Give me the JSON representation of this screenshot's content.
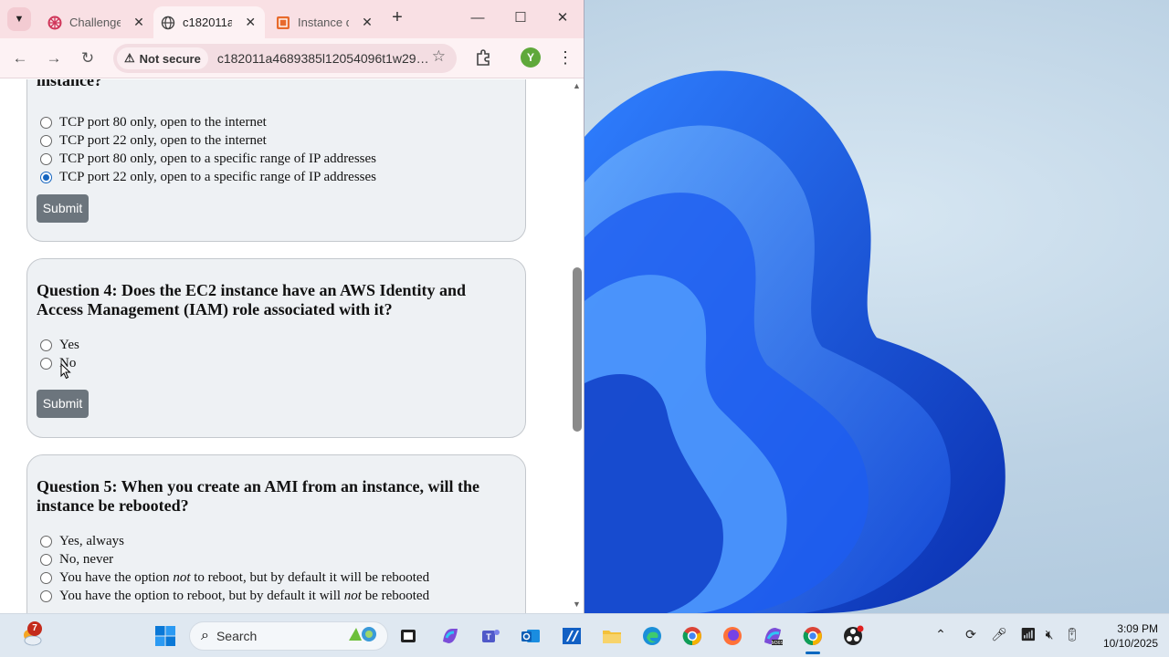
{
  "browser": {
    "tabs": [
      {
        "title": "Challenge",
        "icon": "aws-sandbox-icon",
        "active": false
      },
      {
        "title": "c182011a",
        "icon": "globe-icon",
        "active": true
      },
      {
        "title": "Instance d",
        "icon": "ec2-icon",
        "active": false
      }
    ],
    "security_label": "Not secure",
    "url": "c182011a4689385l12054096t1w298...",
    "profile_initial": "Y"
  },
  "page": {
    "q3": {
      "partial_title": "instance?",
      "options": [
        "TCP port 80 only, open to the internet",
        "TCP port 22 only, open to the internet",
        "TCP port 80 only, open to a specific range of IP addresses",
        "TCP port 22 only, open to a specific range of IP addresses"
      ],
      "selected": 3,
      "submit": "Submit"
    },
    "q4": {
      "title": "Question 4: Does the EC2 instance have an AWS Identity and Access Management (IAM) role associated with it?",
      "options": [
        "Yes",
        "No"
      ],
      "submit": "Submit"
    },
    "q5": {
      "title": "Question 5: When you create an AMI from an instance, will the instance be rebooted?",
      "options": [
        "Yes, always",
        "No, never"
      ],
      "opt3": {
        "pre": "You have the option ",
        "em": "not",
        "post": " to reboot, but by default it will be rebooted"
      },
      "opt4": {
        "pre": "You have the option to reboot, but by default it will ",
        "em": "not",
        "post": " be rebooted"
      }
    }
  },
  "taskbar": {
    "weather_badge": "7",
    "search_label": "Search",
    "time": "3:09 PM",
    "date": "10/10/2025"
  },
  "colors": {
    "accent": "#0067c0",
    "radio_selected": "#1565c0",
    "submit_bg": "#6c757d"
  }
}
